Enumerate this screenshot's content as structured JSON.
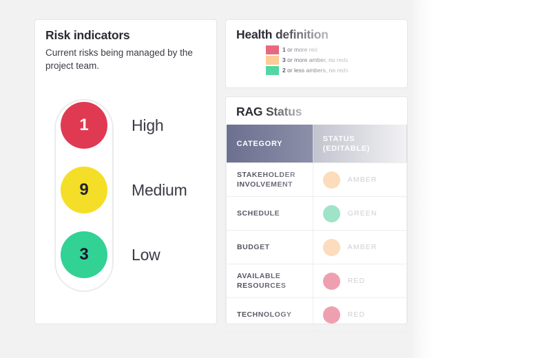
{
  "colors": {
    "page_bg": "#f2f2f3",
    "card_bg": "#ffffff",
    "lamp_high": "#e03a52",
    "lamp_medium": "#f5de27",
    "lamp_low": "#32d295",
    "legend_red": "#e8687e",
    "legend_amber": "#fccb96",
    "legend_green": "#52d6a4",
    "dot_amber": "#fcdcbc",
    "dot_green": "#9fe4c8",
    "dot_red": "#efa0b0",
    "header_left": "#6c7090",
    "header_right": "#f2f2f4"
  },
  "risk_card": {
    "title": "Risk indicators",
    "subtitle": "Current risks being managed by the project team.",
    "lamps": [
      {
        "count": "1",
        "label": "High",
        "color": "#e03a52"
      },
      {
        "count": "9",
        "label": "Medium",
        "color": "#f5de27"
      },
      {
        "count": "3",
        "label": "Low",
        "color": "#32d295"
      }
    ]
  },
  "health_card": {
    "title": "Health definition",
    "legend": [
      {
        "lead": "1",
        "text": " or more red",
        "color": "#e8687e"
      },
      {
        "lead": "3",
        "text": " or more amber, no reds",
        "color": "#fccb96"
      },
      {
        "lead": "2",
        "text": " or less ambers, no reds",
        "color": "#52d6a4"
      }
    ]
  },
  "rag_card": {
    "title": "RAG Status",
    "columns": [
      {
        "label": "CATEGORY",
        "line2": ""
      },
      {
        "label": "STATUS",
        "line2": "(EDITABLE)"
      }
    ],
    "rows": [
      {
        "category": "STAKEHOLDER INVOLVEMENT",
        "status": "AMBER",
        "color": "#fcdcbc"
      },
      {
        "category": "SCHEDULE",
        "status": "GREEN",
        "color": "#9fe4c8"
      },
      {
        "category": "BUDGET",
        "status": "AMBER",
        "color": "#fcdcbc"
      },
      {
        "category": "AVAILABLE RESOURCES",
        "status": "RED",
        "color": "#efa0b0"
      },
      {
        "category": "TECHNOLOGY",
        "status": "RED",
        "color": "#efa0b0"
      }
    ]
  }
}
